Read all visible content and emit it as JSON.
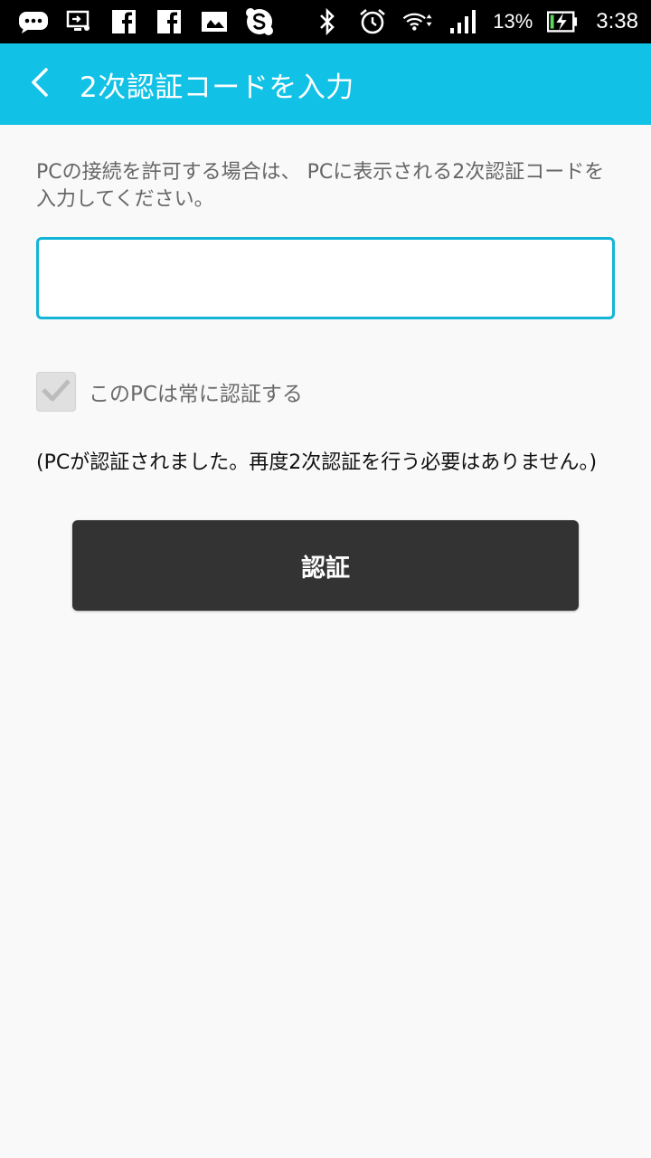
{
  "status_bar": {
    "battery_percent": "13%",
    "time": "3:38",
    "left_icons": [
      "chat-bubble-icon",
      "screen-cast-icon",
      "facebook-icon",
      "facebook-icon",
      "photo-icon",
      "skype-icon"
    ],
    "right_icons": [
      "bluetooth-icon",
      "alarm-icon",
      "wifi-icon",
      "cell-signal-icon",
      "battery-charging-icon"
    ]
  },
  "app_bar": {
    "title": "2次認証コードを入力",
    "background": "#12c2e6"
  },
  "form": {
    "instruction": "PCの接続を許可する場合は、 PCに表示される2次認証コードを 入力してください。",
    "code_value": "",
    "code_placeholder": "",
    "remember_label": "このPCは常に認証する",
    "remember_checked": true,
    "note": "(PCが認証されました。再度2次認証を行う必要はありません。)",
    "submit_label": "認証"
  }
}
